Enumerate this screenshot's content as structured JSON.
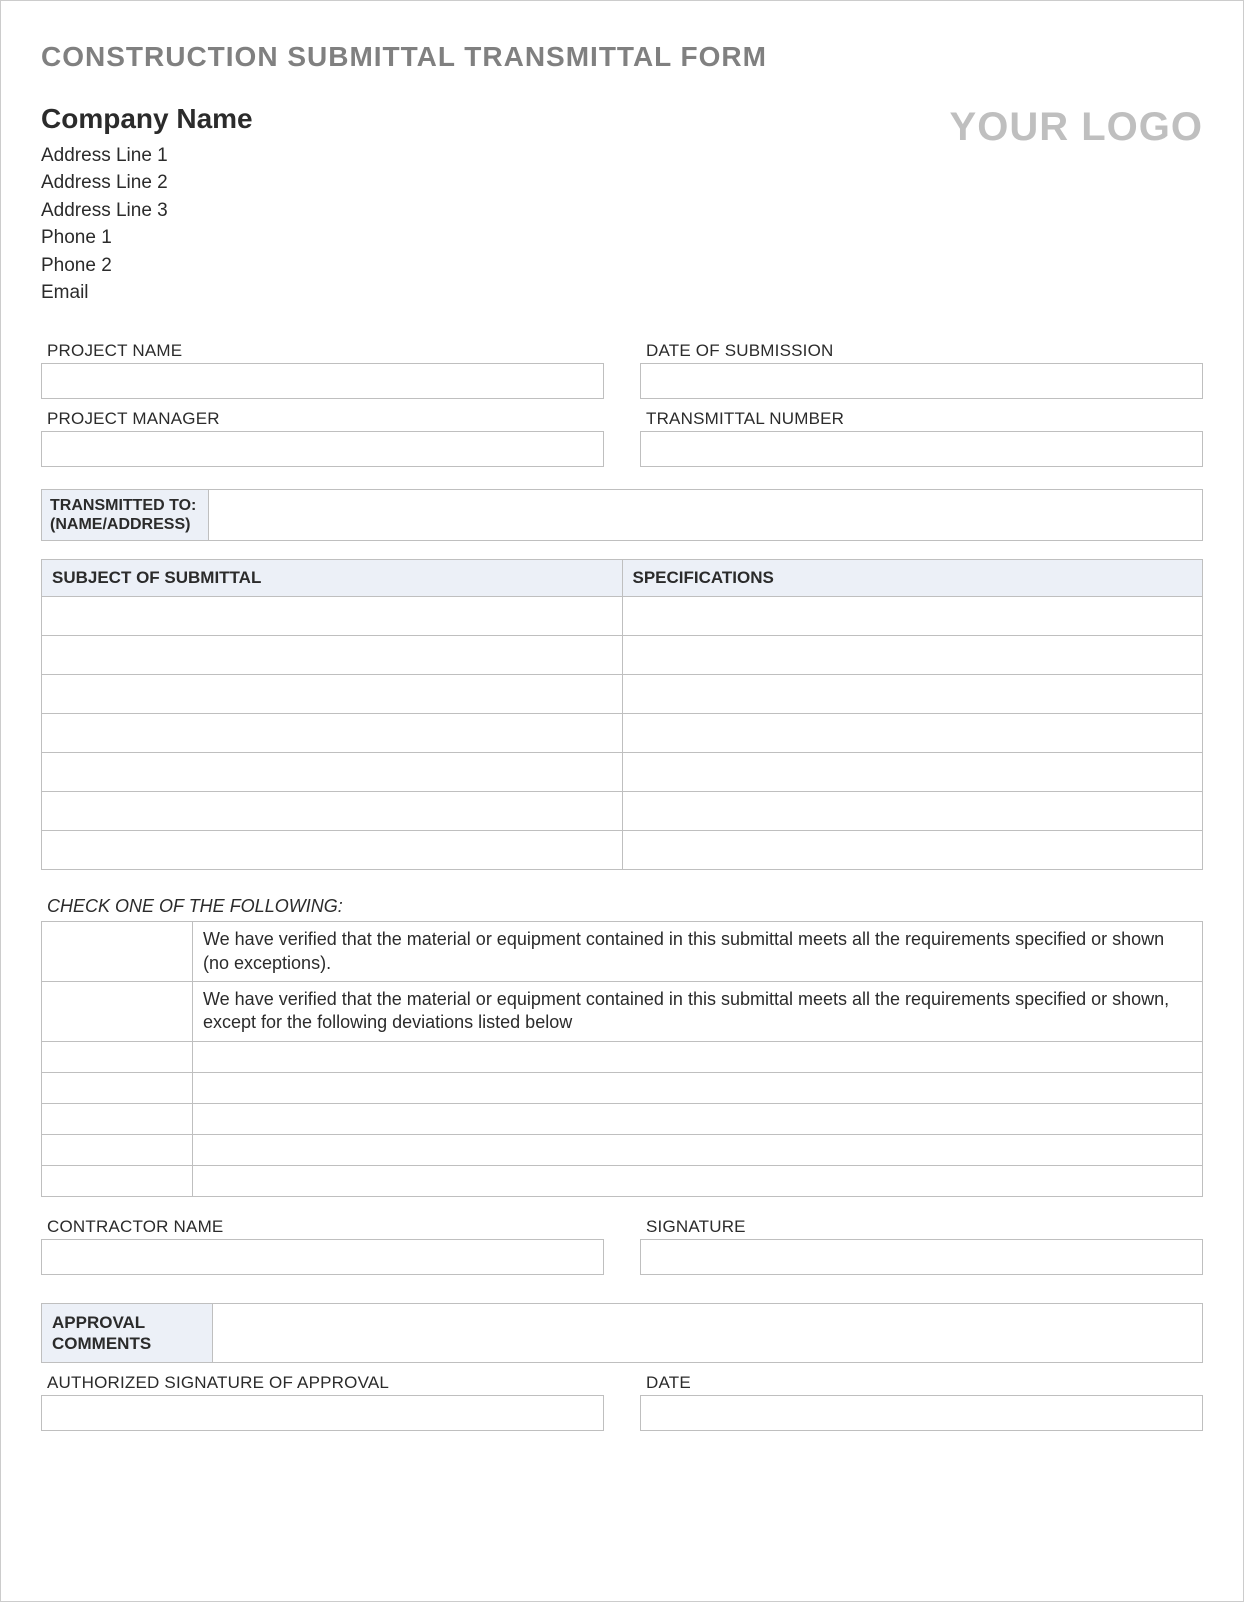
{
  "title": "CONSTRUCTION SUBMITTAL TRANSMITTAL FORM",
  "company": {
    "name": "Company Name",
    "addr1": "Address Line 1",
    "addr2": "Address Line 2",
    "addr3": "Address Line 3",
    "phone1": "Phone 1",
    "phone2": "Phone 2",
    "email": "Email"
  },
  "logo_text": "YOUR LOGO",
  "fields": {
    "project_name_label": "PROJECT NAME",
    "date_submission_label": "DATE OF SUBMISSION",
    "project_manager_label": "PROJECT MANAGER",
    "transmittal_number_label": "TRANSMITTAL NUMBER",
    "contractor_name_label": "CONTRACTOR NAME",
    "signature_label": "SIGNATURE",
    "auth_sig_label": "AUTHORIZED SIGNATURE OF APPROVAL",
    "date_label": "DATE"
  },
  "transmitted_to_label1": "TRANSMITTED TO:",
  "transmitted_to_label2": "(NAME/ADDRESS)",
  "subject_table": {
    "col1": "SUBJECT OF SUBMITTAL",
    "col2": "SPECIFICATIONS",
    "row_count": 7
  },
  "check_section": {
    "title": "CHECK ONE OF THE FOLLOWING:",
    "opt1": "We have verified that the material or equipment contained in this submittal meets all the requirements specified or shown (no exceptions).",
    "opt2": "We have verified that the material or equipment contained in this submittal meets all the requirements specified or shown, except for the following deviations listed below",
    "deviation_row_count": 5
  },
  "approval_comments_label1": "APPROVAL",
  "approval_comments_label2": "COMMENTS"
}
